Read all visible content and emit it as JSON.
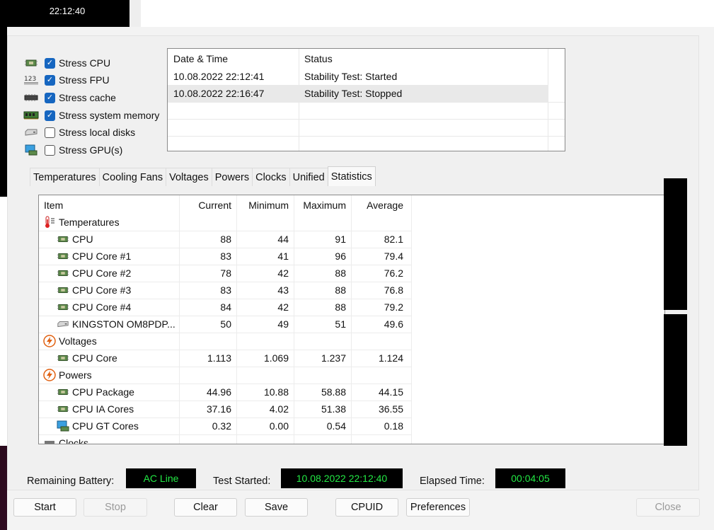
{
  "background": {
    "clock": "22:12:40"
  },
  "stress": [
    {
      "label": "Stress CPU",
      "checked": true,
      "icon": "cpu-chip-icon"
    },
    {
      "label": "Stress FPU",
      "checked": true,
      "icon": "fpu-123-icon"
    },
    {
      "label": "Stress cache",
      "checked": true,
      "icon": "cache-chip-icon"
    },
    {
      "label": "Stress system memory",
      "checked": true,
      "icon": "memory-module-icon"
    },
    {
      "label": "Stress local disks",
      "checked": false,
      "icon": "disk-drive-icon"
    },
    {
      "label": "Stress GPU(s)",
      "checked": false,
      "icon": "gpu-monitor-icon"
    }
  ],
  "log": {
    "headers": [
      "Date & Time",
      "Status"
    ],
    "rows": [
      [
        "10.08.2022 22:12:41",
        "Stability Test: Started"
      ],
      [
        "10.08.2022 22:16:47",
        "Stability Test: Stopped"
      ]
    ]
  },
  "tabs": [
    "Temperatures",
    "Cooling Fans",
    "Voltages",
    "Powers",
    "Clocks",
    "Unified",
    "Statistics"
  ],
  "active_tab": "Statistics",
  "stats": {
    "headers": [
      "Item",
      "Current",
      "Minimum",
      "Maximum",
      "Average"
    ],
    "rows": [
      {
        "type": "group",
        "icon": "thermometer-icon",
        "label": "Temperatures"
      },
      {
        "type": "item",
        "icon": "cpu-chip-icon",
        "label": "CPU",
        "cur": "88",
        "min": "44",
        "max": "91",
        "avg": "82.1"
      },
      {
        "type": "item",
        "icon": "cpu-chip-icon",
        "label": "CPU Core #1",
        "cur": "83",
        "min": "41",
        "max": "96",
        "avg": "79.4"
      },
      {
        "type": "item",
        "icon": "cpu-chip-icon",
        "label": "CPU Core #2",
        "cur": "78",
        "min": "42",
        "max": "88",
        "avg": "76.2"
      },
      {
        "type": "item",
        "icon": "cpu-chip-icon",
        "label": "CPU Core #3",
        "cur": "83",
        "min": "43",
        "max": "88",
        "avg": "76.8"
      },
      {
        "type": "item",
        "icon": "cpu-chip-icon",
        "label": "CPU Core #4",
        "cur": "84",
        "min": "42",
        "max": "88",
        "avg": "79.2"
      },
      {
        "type": "item",
        "icon": "disk-drive-icon",
        "label": "KINGSTON OM8PDP...",
        "cur": "50",
        "min": "49",
        "max": "51",
        "avg": "49.6"
      },
      {
        "type": "group",
        "icon": "lightning-icon",
        "label": "Voltages"
      },
      {
        "type": "item",
        "icon": "cpu-chip-icon",
        "label": "CPU Core",
        "cur": "1.113",
        "min": "1.069",
        "max": "1.237",
        "avg": "1.124"
      },
      {
        "type": "group",
        "icon": "lightning-icon",
        "label": "Powers"
      },
      {
        "type": "item",
        "icon": "cpu-chip-icon",
        "label": "CPU Package",
        "cur": "44.96",
        "min": "10.88",
        "max": "58.88",
        "avg": "44.15"
      },
      {
        "type": "item",
        "icon": "cpu-chip-icon",
        "label": "CPU IA Cores",
        "cur": "37.16",
        "min": "4.02",
        "max": "51.38",
        "avg": "36.55"
      },
      {
        "type": "item",
        "icon": "gpu-monitor-icon",
        "label": "CPU GT Cores",
        "cur": "0.32",
        "min": "0.00",
        "max": "0.54",
        "avg": "0.18"
      },
      {
        "type": "group",
        "icon": "clock-icon",
        "label": "Clocks"
      }
    ]
  },
  "status": {
    "battery_label": "Remaining Battery:",
    "battery_value": "AC Line",
    "started_label": "Test Started:",
    "started_value": "10.08.2022 22:12:40",
    "elapsed_label": "Elapsed Time:",
    "elapsed_value": "00:04:05"
  },
  "buttons": {
    "start": "Start",
    "stop": "Stop",
    "clear": "Clear",
    "save": "Save",
    "cpuid": "CPUID",
    "preferences": "Preferences",
    "close": "Close"
  },
  "colors": {
    "checkbox": "#1666c0",
    "led_text": "#22e844",
    "led_bg": "#000000"
  }
}
